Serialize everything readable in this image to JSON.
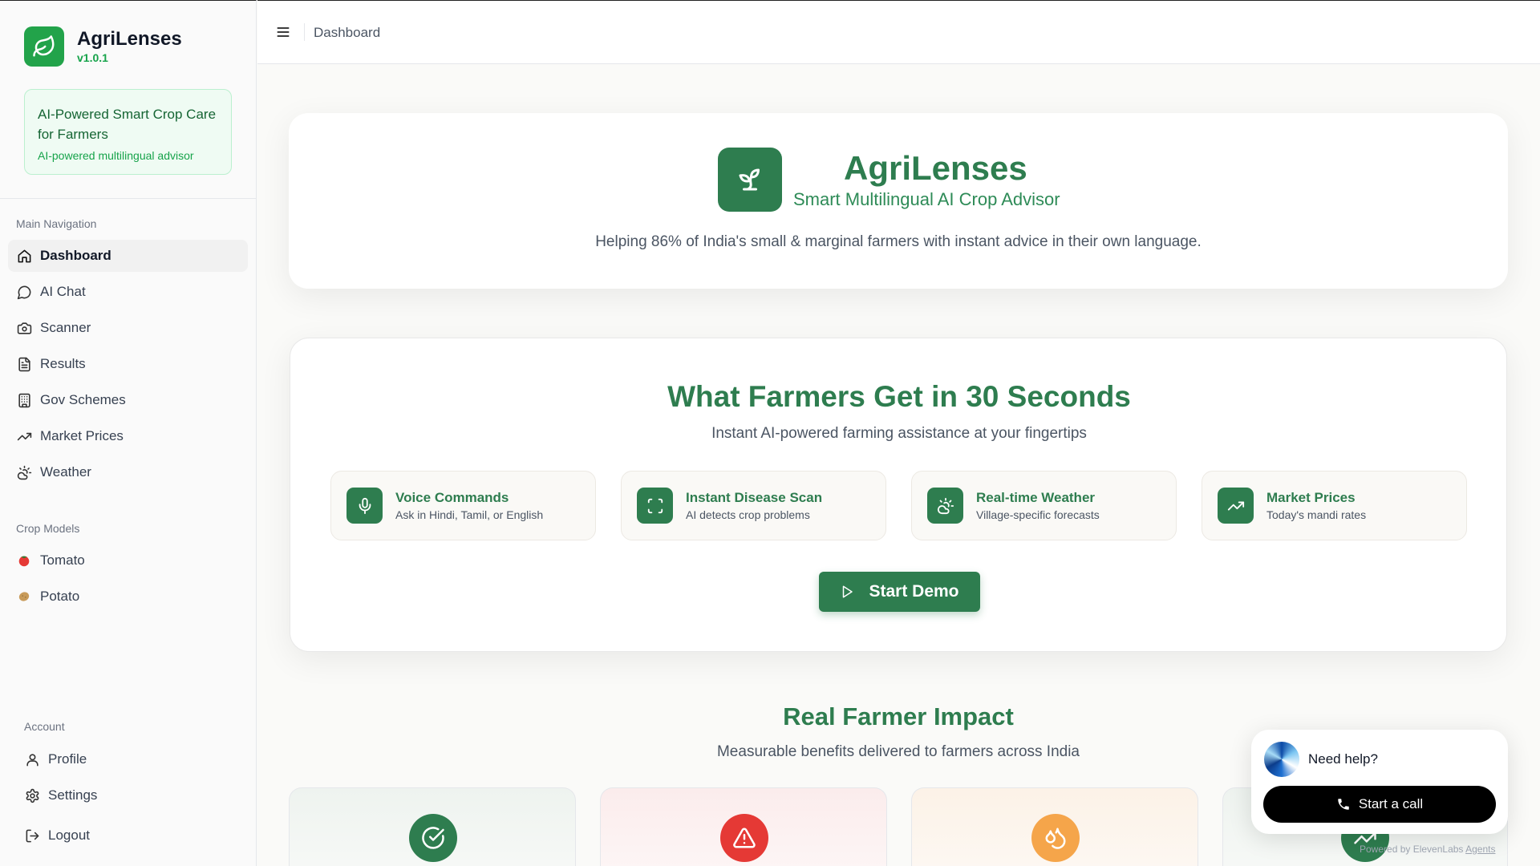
{
  "brand": {
    "name": "AgriLenses",
    "version": "v1.0.1"
  },
  "promo": {
    "title": "AI-Powered Smart Crop Care for Farmers",
    "subtitle": "AI-powered multilingual advisor"
  },
  "sidebar": {
    "main_heading": "Main Navigation",
    "main_items": [
      {
        "label": "Dashboard",
        "icon": "home-icon",
        "active": true
      },
      {
        "label": "AI Chat",
        "icon": "chat-icon"
      },
      {
        "label": "Scanner",
        "icon": "camera-icon"
      },
      {
        "label": "Results",
        "icon": "document-icon"
      },
      {
        "label": "Gov Schemes",
        "icon": "building-icon"
      },
      {
        "label": "Market Prices",
        "icon": "trending-up-icon"
      },
      {
        "label": "Weather",
        "icon": "weather-icon"
      }
    ],
    "crop_heading": "Crop Models",
    "crop_items": [
      {
        "label": "Tomato",
        "icon": "tomato-icon"
      },
      {
        "label": "Potato",
        "icon": "potato-icon"
      }
    ],
    "account_heading": "Account",
    "account_items": [
      {
        "label": "Profile",
        "icon": "user-icon"
      },
      {
        "label": "Settings",
        "icon": "gear-icon"
      },
      {
        "label": "Logout",
        "icon": "logout-icon"
      }
    ]
  },
  "topbar": {
    "breadcrumb": "Dashboard",
    "menu_icon": "hamburger-icon"
  },
  "hero": {
    "title": "AgriLenses",
    "subtitle": "Smart Multilingual AI Crop Advisor",
    "description": "Helping 86% of India's small & marginal farmers with instant advice in their own language.",
    "icon": "sprout-icon"
  },
  "features": {
    "title": "What Farmers Get in 30 Seconds",
    "subtitle": "Instant AI-powered farming assistance at your fingertips",
    "items": [
      {
        "name": "Voice Commands",
        "desc": "Ask in Hindi, Tamil, or English",
        "icon": "microphone-icon"
      },
      {
        "name": "Instant Disease Scan",
        "desc": "AI detects crop problems",
        "icon": "scan-icon"
      },
      {
        "name": "Real-time Weather",
        "desc": "Village-specific forecasts",
        "icon": "weather-icon"
      },
      {
        "name": "Market Prices",
        "desc": "Today's mandi rates",
        "icon": "trending-up-icon"
      }
    ],
    "cta": "Start Demo"
  },
  "impact": {
    "title": "Real Farmer Impact",
    "subtitle": "Measurable benefits delivered to farmers across India",
    "cards": [
      {
        "icon": "check-circle-icon",
        "color": "#2e7d4f"
      },
      {
        "icon": "alert-triangle-icon",
        "color": "#e53935"
      },
      {
        "icon": "droplets-icon",
        "color": "#f5a54a"
      },
      {
        "icon": "trending-up-icon",
        "color": "#2e7d4f"
      }
    ]
  },
  "help_widget": {
    "title": "Need help?",
    "button": "Start a call",
    "powered_prefix": "Powered by ElevenLabs",
    "powered_link": "Agents"
  },
  "colors": {
    "primary": "#2e7d4f",
    "brand_green": "#22a34a",
    "danger": "#e53935",
    "warning": "#f5a54a"
  }
}
